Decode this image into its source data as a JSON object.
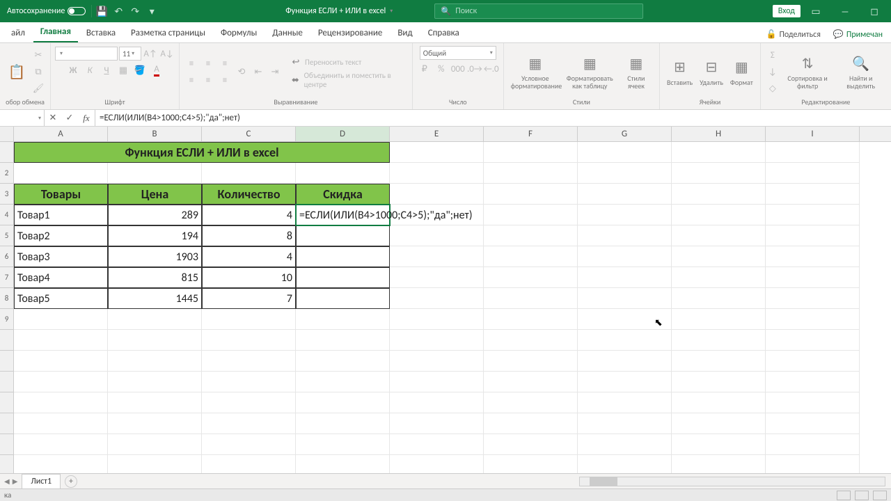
{
  "titlebar": {
    "autosave": "Автосохранение",
    "doc_title": "Функция ЕСЛИ + ИЛИ в excel",
    "search_placeholder": "Поиск",
    "login": "Вход"
  },
  "tabs": {
    "file": "айл",
    "home": "Главная",
    "insert": "Вставка",
    "layout": "Разметка страницы",
    "formulas": "Формулы",
    "data": "Данные",
    "review": "Рецензирование",
    "view": "Вид",
    "help": "Справка",
    "share": "Поделиться",
    "comments": "Примечан"
  },
  "ribbon": {
    "clipboard": "обор обмена",
    "font": "Шрифт",
    "font_size": "11",
    "alignment": "Выравнивание",
    "wrap": "Переносить текст",
    "merge": "Объединить и поместить в центре",
    "number": "Число",
    "number_format": "Общий",
    "styles": "Стили",
    "cond_format": "Условное форматирование",
    "format_table": "Форматировать как таблицу",
    "cell_styles": "Стили ячеек",
    "cells": "Ячейки",
    "insert_c": "Вставить",
    "delete_c": "Удалить",
    "format_c": "Формат",
    "editing": "Редактирование",
    "sort": "Сортировка и фильтр",
    "find": "Найти и выделить"
  },
  "namebox": "",
  "formula": "=ЕСЛИ(ИЛИ(B4>1000;C4>5);\"да\";нет)",
  "sheet": {
    "title": "Функция ЕСЛИ + ИЛИ в excel",
    "headers": {
      "a": "Товары",
      "b": "Цена",
      "c": "Количество",
      "d": "Скидка"
    },
    "rows": [
      {
        "name": "Товар1",
        "price": "289",
        "qty": "4",
        "disc": ""
      },
      {
        "name": "Товар2",
        "price": "194",
        "qty": "8",
        "disc": ""
      },
      {
        "name": "Товар3",
        "price": "1903",
        "qty": "4",
        "disc": ""
      },
      {
        "name": "Товар4",
        "price": "815",
        "qty": "10",
        "disc": ""
      },
      {
        "name": "Товар5",
        "price": "1445",
        "qty": "7",
        "disc": ""
      }
    ],
    "editing_formula": "=ЕСЛИ(ИЛИ(B4>1000;C4>5);\"да\";нет)"
  },
  "sheet_tab": "Лист1",
  "status": "ка"
}
